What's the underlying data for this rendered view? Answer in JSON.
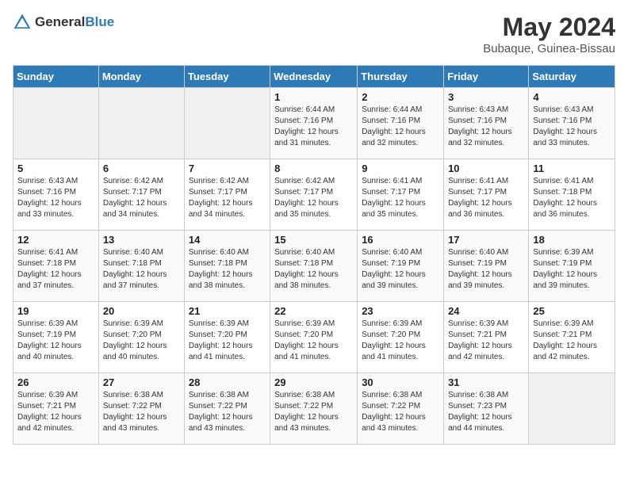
{
  "logo": {
    "general": "General",
    "blue": "Blue"
  },
  "title": {
    "month_year": "May 2024",
    "location": "Bubaque, Guinea-Bissau"
  },
  "headers": [
    "Sunday",
    "Monday",
    "Tuesday",
    "Wednesday",
    "Thursday",
    "Friday",
    "Saturday"
  ],
  "weeks": [
    [
      {
        "day": "",
        "info": ""
      },
      {
        "day": "",
        "info": ""
      },
      {
        "day": "",
        "info": ""
      },
      {
        "day": "1",
        "info": "Sunrise: 6:44 AM\nSunset: 7:16 PM\nDaylight: 12 hours and 31 minutes."
      },
      {
        "day": "2",
        "info": "Sunrise: 6:44 AM\nSunset: 7:16 PM\nDaylight: 12 hours and 32 minutes."
      },
      {
        "day": "3",
        "info": "Sunrise: 6:43 AM\nSunset: 7:16 PM\nDaylight: 12 hours and 32 minutes."
      },
      {
        "day": "4",
        "info": "Sunrise: 6:43 AM\nSunset: 7:16 PM\nDaylight: 12 hours and 33 minutes."
      }
    ],
    [
      {
        "day": "5",
        "info": "Sunrise: 6:43 AM\nSunset: 7:16 PM\nDaylight: 12 hours and 33 minutes."
      },
      {
        "day": "6",
        "info": "Sunrise: 6:42 AM\nSunset: 7:17 PM\nDaylight: 12 hours and 34 minutes."
      },
      {
        "day": "7",
        "info": "Sunrise: 6:42 AM\nSunset: 7:17 PM\nDaylight: 12 hours and 34 minutes."
      },
      {
        "day": "8",
        "info": "Sunrise: 6:42 AM\nSunset: 7:17 PM\nDaylight: 12 hours and 35 minutes."
      },
      {
        "day": "9",
        "info": "Sunrise: 6:41 AM\nSunset: 7:17 PM\nDaylight: 12 hours and 35 minutes."
      },
      {
        "day": "10",
        "info": "Sunrise: 6:41 AM\nSunset: 7:17 PM\nDaylight: 12 hours and 36 minutes."
      },
      {
        "day": "11",
        "info": "Sunrise: 6:41 AM\nSunset: 7:18 PM\nDaylight: 12 hours and 36 minutes."
      }
    ],
    [
      {
        "day": "12",
        "info": "Sunrise: 6:41 AM\nSunset: 7:18 PM\nDaylight: 12 hours and 37 minutes."
      },
      {
        "day": "13",
        "info": "Sunrise: 6:40 AM\nSunset: 7:18 PM\nDaylight: 12 hours and 37 minutes."
      },
      {
        "day": "14",
        "info": "Sunrise: 6:40 AM\nSunset: 7:18 PM\nDaylight: 12 hours and 38 minutes."
      },
      {
        "day": "15",
        "info": "Sunrise: 6:40 AM\nSunset: 7:18 PM\nDaylight: 12 hours and 38 minutes."
      },
      {
        "day": "16",
        "info": "Sunrise: 6:40 AM\nSunset: 7:19 PM\nDaylight: 12 hours and 39 minutes."
      },
      {
        "day": "17",
        "info": "Sunrise: 6:40 AM\nSunset: 7:19 PM\nDaylight: 12 hours and 39 minutes."
      },
      {
        "day": "18",
        "info": "Sunrise: 6:39 AM\nSunset: 7:19 PM\nDaylight: 12 hours and 39 minutes."
      }
    ],
    [
      {
        "day": "19",
        "info": "Sunrise: 6:39 AM\nSunset: 7:19 PM\nDaylight: 12 hours and 40 minutes."
      },
      {
        "day": "20",
        "info": "Sunrise: 6:39 AM\nSunset: 7:20 PM\nDaylight: 12 hours and 40 minutes."
      },
      {
        "day": "21",
        "info": "Sunrise: 6:39 AM\nSunset: 7:20 PM\nDaylight: 12 hours and 41 minutes."
      },
      {
        "day": "22",
        "info": "Sunrise: 6:39 AM\nSunset: 7:20 PM\nDaylight: 12 hours and 41 minutes."
      },
      {
        "day": "23",
        "info": "Sunrise: 6:39 AM\nSunset: 7:20 PM\nDaylight: 12 hours and 41 minutes."
      },
      {
        "day": "24",
        "info": "Sunrise: 6:39 AM\nSunset: 7:21 PM\nDaylight: 12 hours and 42 minutes."
      },
      {
        "day": "25",
        "info": "Sunrise: 6:39 AM\nSunset: 7:21 PM\nDaylight: 12 hours and 42 minutes."
      }
    ],
    [
      {
        "day": "26",
        "info": "Sunrise: 6:39 AM\nSunset: 7:21 PM\nDaylight: 12 hours and 42 minutes."
      },
      {
        "day": "27",
        "info": "Sunrise: 6:38 AM\nSunset: 7:22 PM\nDaylight: 12 hours and 43 minutes."
      },
      {
        "day": "28",
        "info": "Sunrise: 6:38 AM\nSunset: 7:22 PM\nDaylight: 12 hours and 43 minutes."
      },
      {
        "day": "29",
        "info": "Sunrise: 6:38 AM\nSunset: 7:22 PM\nDaylight: 12 hours and 43 minutes."
      },
      {
        "day": "30",
        "info": "Sunrise: 6:38 AM\nSunset: 7:22 PM\nDaylight: 12 hours and 43 minutes."
      },
      {
        "day": "31",
        "info": "Sunrise: 6:38 AM\nSunset: 7:23 PM\nDaylight: 12 hours and 44 minutes."
      },
      {
        "day": "",
        "info": ""
      }
    ]
  ]
}
